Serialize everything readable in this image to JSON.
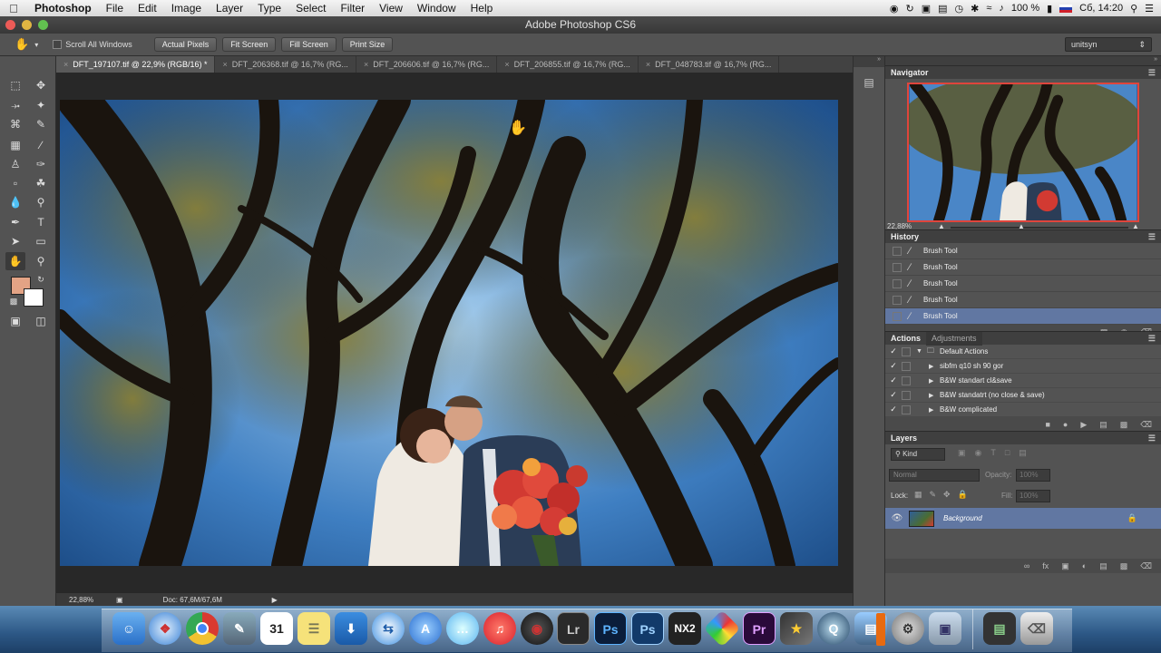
{
  "menubar": {
    "app": "Photoshop",
    "items": [
      "File",
      "Edit",
      "Image",
      "Layer",
      "Type",
      "Select",
      "Filter",
      "View",
      "Window",
      "Help"
    ],
    "battery": "100 %",
    "clock": "Сб, 14:20"
  },
  "window": {
    "title": "Adobe Photoshop CS6"
  },
  "options": {
    "scroll_all": "Scroll All Windows",
    "buttons": [
      "Actual Pixels",
      "Fit Screen",
      "Fill Screen",
      "Print Size"
    ],
    "workspace": "unitsyn"
  },
  "tabs": [
    {
      "label": "DFT_197107.tif @ 22,9% (RGB/16) *"
    },
    {
      "label": "DFT_206368.tif @ 16,7% (RG..."
    },
    {
      "label": "DFT_206606.tif @ 16,7% (RG..."
    },
    {
      "label": "DFT_206855.tif @ 16,7% (RG..."
    },
    {
      "label": "DFT_048783.tif @ 16,7% (RG..."
    }
  ],
  "status": {
    "zoom": "22,88%",
    "doc": "Doc: 67,6M/67,6M"
  },
  "navigator": {
    "title": "Navigator",
    "zoom": "22,88%"
  },
  "history": {
    "title": "History",
    "items": [
      "Brush Tool",
      "Brush Tool",
      "Brush Tool",
      "Brush Tool",
      "Brush Tool"
    ]
  },
  "actions": {
    "tab1": "Actions",
    "tab2": "Adjustments",
    "set": "Default Actions",
    "items": [
      "sibfm q10 sh 90 gor",
      "B&W standart cl&save",
      "B&W standatrt (no close & save)",
      "B&W complicated"
    ]
  },
  "layers": {
    "title": "Layers",
    "kind": "Kind",
    "blend": "Normal",
    "opacity_label": "Opacity:",
    "opacity": "100%",
    "lock_label": "Lock:",
    "fill_label": "Fill:",
    "fill": "100%",
    "layer_name": "Background"
  },
  "dock": {
    "calendar_day": "31",
    "lr": "Lr",
    "ps": "Ps",
    "pr": "Pr",
    "nx2": "NX2"
  },
  "colors": {
    "foreground": "#e3a385",
    "background": "#ffffff",
    "selection": "#6177a2"
  }
}
